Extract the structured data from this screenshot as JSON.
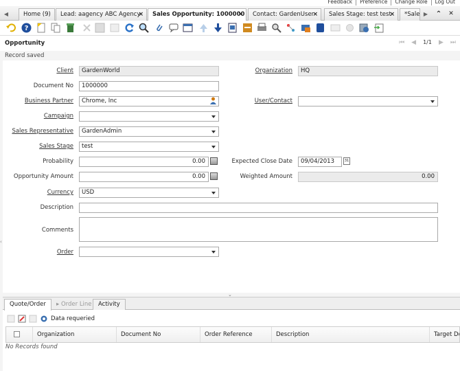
{
  "header_links": [
    "Feedback",
    "Preference",
    "Change Role",
    "Log Out"
  ],
  "tabs": [
    {
      "label": "Home (9)",
      "active": false,
      "closable": false
    },
    {
      "label": "Lead: aagency ABC Agency",
      "active": false,
      "closable": true
    },
    {
      "label": "Sales Opportunity: 1000000",
      "active": true,
      "closable": true
    },
    {
      "label": "Contact: GardenUser",
      "active": false,
      "closable": true
    },
    {
      "label": "Sales Stage: test test",
      "active": false,
      "closable": true
    },
    {
      "label": "*Sale",
      "active": false,
      "closable": false
    }
  ],
  "window": {
    "title": "Opportunity",
    "record_counter": "1/1",
    "status": "Record saved"
  },
  "fields": {
    "client": {
      "label": "Client",
      "value": "GardenWorld"
    },
    "organization": {
      "label": "Organization",
      "value": "HQ"
    },
    "document_no": {
      "label": "Document No",
      "value": "1000000"
    },
    "business_partner": {
      "label": "Business Partner",
      "value": "Chrome, Inc"
    },
    "user_contact": {
      "label": "User/Contact",
      "value": ""
    },
    "campaign": {
      "label": "Campaign",
      "value": ""
    },
    "sales_rep": {
      "label": "Sales Representative",
      "value": "GardenAdmin"
    },
    "sales_stage": {
      "label": "Sales Stage",
      "value": "test"
    },
    "probability": {
      "label": "Probability",
      "value": "0.00"
    },
    "expected_close": {
      "label": "Expected Close Date",
      "value": "09/04/2013"
    },
    "opp_amount": {
      "label": "Opportunity Amount",
      "value": "0.00"
    },
    "weighted_amount": {
      "label": "Weighted Amount",
      "value": "0.00"
    },
    "currency": {
      "label": "Currency",
      "value": "USD"
    },
    "description": {
      "label": "Description",
      "value": ""
    },
    "comments": {
      "label": "Comments",
      "value": ""
    },
    "order": {
      "label": "Order",
      "value": ""
    }
  },
  "detail_tabs": [
    {
      "label": "Quote/Order",
      "state": "active"
    },
    {
      "label": "Order Line",
      "state": "disabled"
    },
    {
      "label": "Activity",
      "state": "normal"
    }
  ],
  "detail": {
    "status": "Data requeried",
    "columns": [
      "Organization",
      "Document No",
      "Order Reference",
      "Description",
      "Target Dc"
    ],
    "empty_text": "No Records found"
  },
  "colors": {
    "accent_blue": "#1f4e9c",
    "tab_active_bg": "#ffffff",
    "readonly_bg": "#ebebeb"
  }
}
